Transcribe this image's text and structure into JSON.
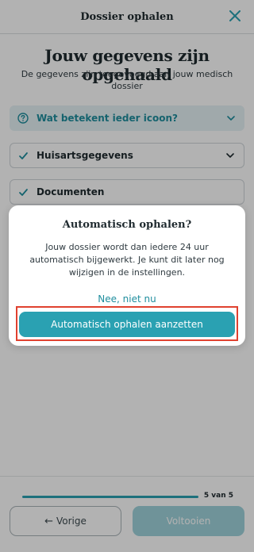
{
  "header": {
    "title": "Dossier ophalen",
    "close_icon": "close-icon"
  },
  "main": {
    "title": "Jouw gegevens zijn opgehaald",
    "subtitle": "De gegevens zijn toegevoegd aan jouw medisch dossier",
    "info_card": {
      "label": "Wat betekent ieder icoon?",
      "icon": "question-circle-icon"
    },
    "cards": [
      {
        "label": "Huisartsgegevens",
        "icon": "check-icon"
      },
      {
        "label": "Documenten",
        "icon": "check-icon"
      }
    ]
  },
  "footer": {
    "progress": {
      "current": 5,
      "total": 5,
      "text": "5 van 5",
      "fraction": 1.0
    },
    "back_label": "Vorige",
    "finish_label": "Voltooien"
  },
  "dialog": {
    "title": "Automatisch ophalen?",
    "body": "Jouw dossier wordt dan iedere 24 uur automatisch bijgewerkt. Je kunt dit later nog wijzigen in de instellingen.",
    "secondary_label": "Nee, niet nu",
    "primary_label": "Automatisch ophalen aanzetten"
  },
  "colors": {
    "accent": "#2aa1b2",
    "accent_light": "#9fd3db",
    "link": "#1f8e9e",
    "highlight": "#e0412f",
    "text": "#1f2a2f"
  }
}
